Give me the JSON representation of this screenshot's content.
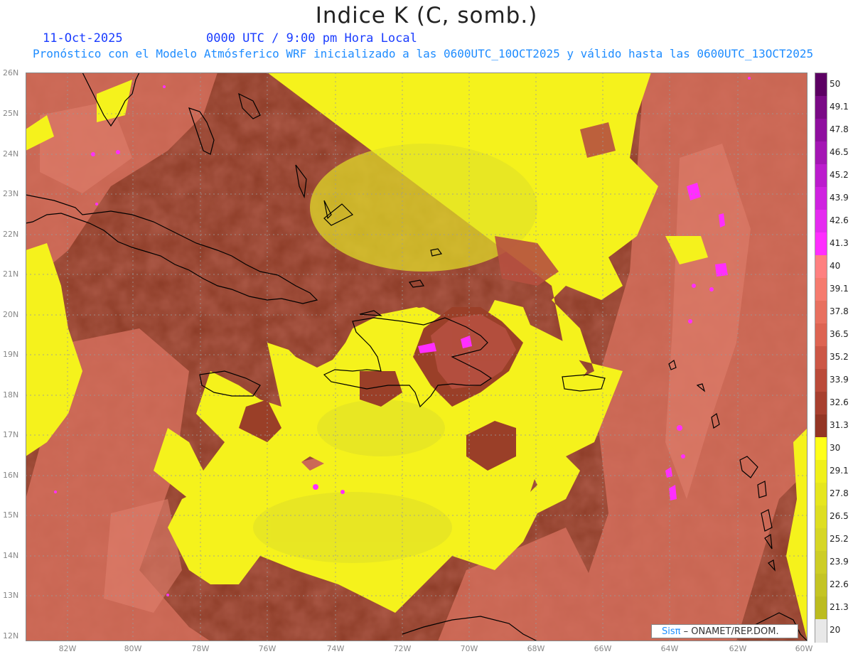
{
  "header": {
    "title": "Indice K (C, somb.)",
    "date": "11-Oct-2025",
    "time": "0000 UTC / 9:00 pm Hora Local",
    "description": "Pronóstico con el Modelo Atmósferico WRF inicializado a las 0600UTC_10OCT2025 y válido hasta las  0600UTC_13OCT2025"
  },
  "axes": {
    "lat_labels": [
      "26N",
      "25N",
      "24N",
      "23N",
      "22N",
      "21N",
      "20N",
      "19N",
      "18N",
      "17N",
      "16N",
      "15N",
      "14N",
      "13N",
      "12N"
    ],
    "lon_labels": [
      "82W",
      "80W",
      "78W",
      "76W",
      "74W",
      "72W",
      "70W",
      "68W",
      "66W",
      "64W",
      "62W",
      "60W"
    ],
    "lat_range": [
      12,
      26
    ],
    "lon_range": [
      -83.2,
      -60
    ]
  },
  "legend": {
    "labels": [
      "50",
      "49.1",
      "47.8",
      "46.5",
      "45.2",
      "43.9",
      "42.6",
      "41.3",
      "40",
      "39.1",
      "37.8",
      "36.5",
      "35.2",
      "33.9",
      "32.6",
      "31.3",
      "30",
      "29.1",
      "27.8",
      "26.5",
      "25.2",
      "23.9",
      "22.6",
      "21.3",
      "20"
    ],
    "colors": [
      "#5c0063",
      "#7a0a86",
      "#8f0f9f",
      "#a416b4",
      "#bb1ccd",
      "#cf22e0",
      "#e52bf0",
      "#ff2eff",
      "#ff8080",
      "#f57b6e",
      "#e8705f",
      "#dd6452",
      "#cc5746",
      "#bb4b3a",
      "#a8402f",
      "#943625",
      "#ffff1a",
      "#f0f01a",
      "#e6e61e",
      "#dede22",
      "#d6d626",
      "#cdcd26",
      "#c4c424",
      "#bcbc20",
      "#e8e8e8"
    ]
  },
  "credit": {
    "brand": "Sisπ",
    "text": "– ONAMET/REP.DOM."
  }
}
